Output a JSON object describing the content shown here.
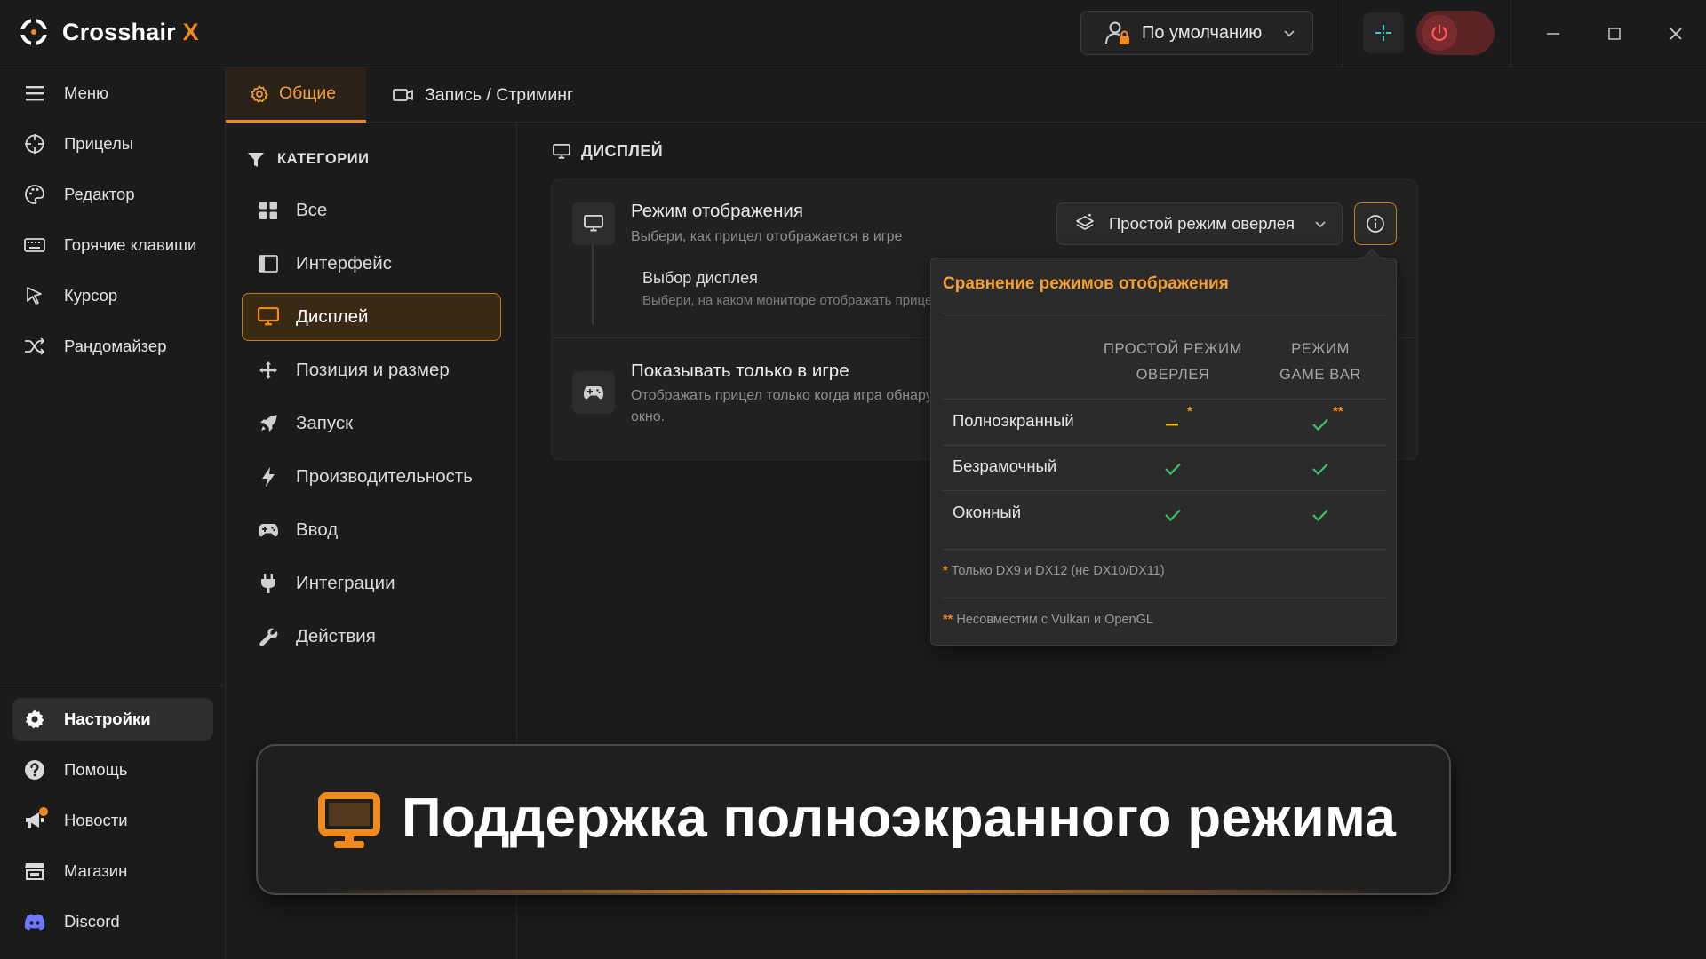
{
  "app": {
    "name_main": "Crosshair",
    "name_accent": "X"
  },
  "topbar": {
    "profile_label": "По умолчанию"
  },
  "nav": {
    "items": [
      {
        "label": "Меню"
      },
      {
        "label": "Прицелы"
      },
      {
        "label": "Редактор"
      },
      {
        "label": "Горячие клавиши"
      },
      {
        "label": "Курсор"
      },
      {
        "label": "Рандомайзер"
      },
      {
        "label": "Настройки"
      },
      {
        "label": "Помощь"
      },
      {
        "label": "Новости"
      },
      {
        "label": "Магазин"
      },
      {
        "label": "Discord"
      }
    ]
  },
  "tabs": [
    {
      "label": "Общие"
    },
    {
      "label": "Запись / Стриминг"
    }
  ],
  "categories": {
    "title": "КАТЕГОРИИ",
    "items": [
      {
        "label": "Все"
      },
      {
        "label": "Интерфейс"
      },
      {
        "label": "Дисплей"
      },
      {
        "label": "Позиция и размер"
      },
      {
        "label": "Запуск"
      },
      {
        "label": "Производительность"
      },
      {
        "label": "Ввод"
      },
      {
        "label": "Интеграции"
      },
      {
        "label": "Действия"
      }
    ]
  },
  "section": {
    "title": "ДИСПЛЕЙ"
  },
  "settings": {
    "display_mode": {
      "title": "Режим отображения",
      "desc": "Выбери, как прицел отображается в игре",
      "value": "Простой режим оверлея"
    },
    "display_select": {
      "title": "Выбор дисплея",
      "desc": "Выбери, на каком мониторе отображать прицел"
    },
    "only_in_game": {
      "title": "Показывать только в игре",
      "desc_line1": "Отображать прицел только когда игра обнаружена как активное",
      "desc_line2": "окно."
    }
  },
  "popover": {
    "title": "Сравнение режимов отображения",
    "col1_line1": "ПРОСТОЙ РЕЖИМ",
    "col1_line2": "ОВЕРЛЕЯ",
    "col2_line1": "РЕЖИМ",
    "col2_line2": "GAME BAR",
    "rows": [
      {
        "label": "Полноэкранный",
        "col1": "partial",
        "col1_mark": "*",
        "col2": "check",
        "col2_mark": "**"
      },
      {
        "label": "Безрамочный",
        "col1": "check",
        "col2": "check"
      },
      {
        "label": "Оконный",
        "col1": "check",
        "col2": "check"
      }
    ],
    "note1_mark": "*",
    "note1": " Только DX9 и DX12 (не DX10/DX11)",
    "note2_mark": "**",
    "note2": " Несовместим с Vulkan и OpenGL"
  },
  "banner": {
    "text": "Поддержка полноэкранного режима"
  },
  "colors": {
    "accent": "#f08a1c",
    "check": "#3fbf6a",
    "power_bg": "#5a2326",
    "active_category_bg": "#3a2a14"
  }
}
